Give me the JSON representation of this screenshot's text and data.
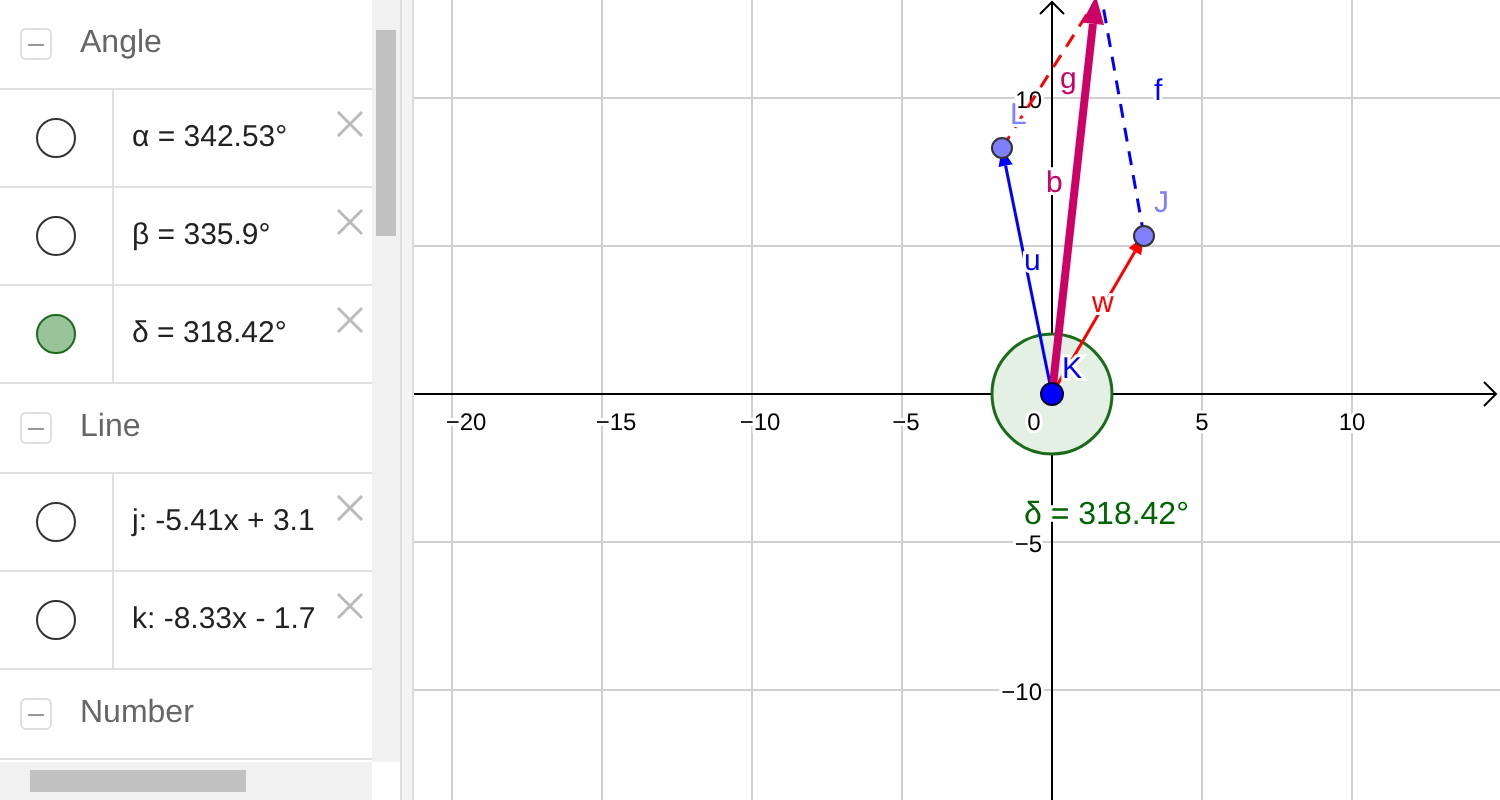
{
  "algebra": {
    "sections": [
      {
        "title": "Angle",
        "items": [
          {
            "text": "α = 342.53°",
            "shown": false
          },
          {
            "text": "β = 335.9°",
            "shown": false
          },
          {
            "text": "δ = 318.42°",
            "shown": true
          }
        ]
      },
      {
        "title": "Line",
        "items": [
          {
            "text": "j: -5.41x + 3.1",
            "shown": false
          },
          {
            "text": "k: -8.33x - 1.7",
            "shown": false
          }
        ]
      },
      {
        "title": "Number"
      }
    ]
  },
  "graphics": {
    "x_ticks": [
      "−20",
      "−15",
      "−10",
      "−5",
      "0",
      "5",
      "10"
    ],
    "y_ticks": [
      "10",
      "−5",
      "−10"
    ],
    "objects": [
      {
        "kind": "dashed",
        "label": "g"
      },
      {
        "kind": "dashed",
        "label": "f"
      },
      {
        "kind": "vector",
        "label": "u"
      },
      {
        "kind": "vector",
        "label": "w"
      },
      {
        "kind": "thick_vector",
        "label": "b"
      },
      {
        "kind": "point",
        "label": "L"
      },
      {
        "kind": "point",
        "label": "J"
      },
      {
        "kind": "origin_point",
        "label": "K"
      }
    ],
    "angle_label": "δ = 318.42°"
  }
}
